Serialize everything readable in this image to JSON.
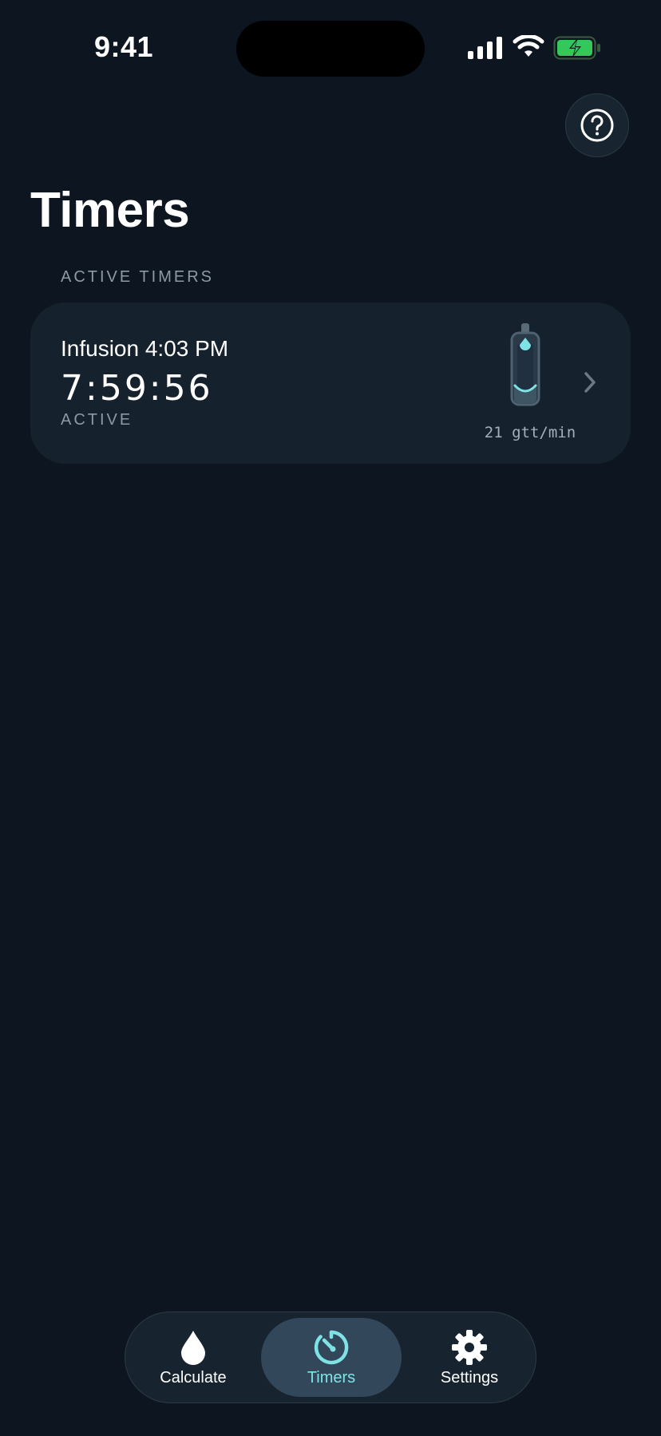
{
  "status_bar": {
    "time": "9:41"
  },
  "header": {
    "title": "Timers",
    "help_icon": "question-circle-icon"
  },
  "section": {
    "header": "ACTIVE TIMERS"
  },
  "timers": [
    {
      "name": "Infusion 4:03 PM",
      "countdown": "7:59:56",
      "status": "ACTIVE",
      "rate": "21 gtt/min"
    }
  ],
  "tab_bar": {
    "tabs": [
      {
        "label": "Calculate",
        "icon": "drop-icon",
        "selected": false
      },
      {
        "label": "Timers",
        "icon": "timer-icon",
        "selected": true
      },
      {
        "label": "Settings",
        "icon": "gear-icon",
        "selected": false
      }
    ]
  },
  "colors": {
    "background": "#0d1620",
    "card": "#15222d",
    "accent": "#7fe3e6",
    "secondary_text": "#8c9aa5",
    "battery": "#34c759"
  }
}
